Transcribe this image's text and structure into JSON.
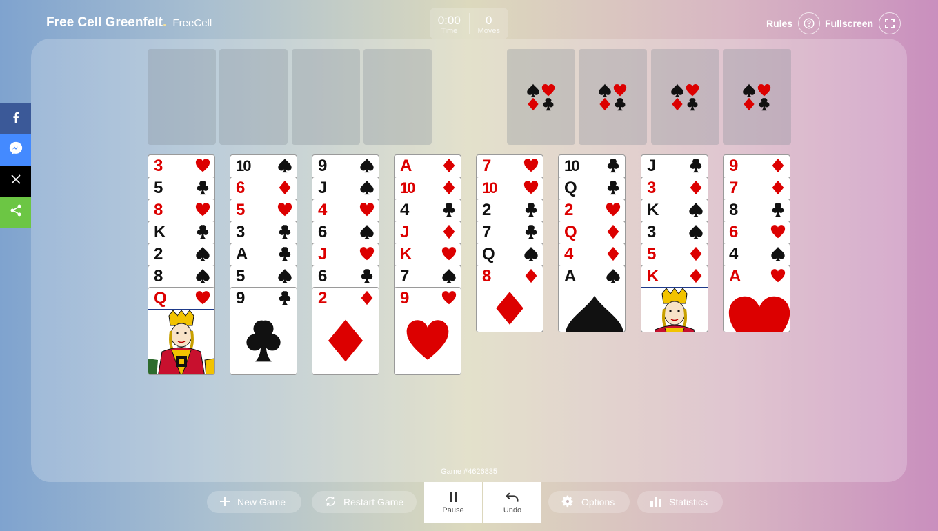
{
  "header": {
    "brand_title": "Free Cell Greenfelt",
    "brand_dot": ".",
    "brand_subtitle": "FreeCell"
  },
  "hud": {
    "time_value": "0:00",
    "time_label": "Time",
    "moves_value": "0",
    "moves_label": "Moves"
  },
  "top_right": {
    "rules_label": "Rules",
    "fullscreen_label": "Fullscreen"
  },
  "share_bar": [
    {
      "name": "facebook",
      "color": "#3b5998",
      "icon": "facebook-icon"
    },
    {
      "name": "messenger",
      "color": "#448aff",
      "icon": "messenger-icon"
    },
    {
      "name": "x",
      "color": "#000000",
      "icon": "x-icon"
    },
    {
      "name": "share",
      "color": "#6cc644",
      "icon": "share-icon"
    }
  ],
  "free_cells": 4,
  "foundations": 4,
  "tableau": [
    [
      [
        "3",
        "H"
      ],
      [
        "5",
        "C"
      ],
      [
        "8",
        "H"
      ],
      [
        "K",
        "C"
      ],
      [
        "2",
        "S"
      ],
      [
        "8",
        "S"
      ],
      [
        "Q",
        "H"
      ]
    ],
    [
      [
        "10",
        "S"
      ],
      [
        "6",
        "D"
      ],
      [
        "5",
        "H"
      ],
      [
        "3",
        "C"
      ],
      [
        "A",
        "C"
      ],
      [
        "5",
        "S"
      ],
      [
        "9",
        "C"
      ]
    ],
    [
      [
        "9",
        "S"
      ],
      [
        "J",
        "S"
      ],
      [
        "4",
        "H"
      ],
      [
        "6",
        "S"
      ],
      [
        "J",
        "H"
      ],
      [
        "6",
        "C"
      ],
      [
        "2",
        "D"
      ]
    ],
    [
      [
        "A",
        "D"
      ],
      [
        "10",
        "D"
      ],
      [
        "4",
        "C"
      ],
      [
        "J",
        "D"
      ],
      [
        "K",
        "H"
      ],
      [
        "7",
        "S"
      ],
      [
        "9",
        "H"
      ]
    ],
    [
      [
        "7",
        "H"
      ],
      [
        "10",
        "H"
      ],
      [
        "2",
        "C"
      ],
      [
        "7",
        "C"
      ],
      [
        "Q",
        "S"
      ],
      [
        "8",
        "D"
      ]
    ],
    [
      [
        "10",
        "C"
      ],
      [
        "Q",
        "C"
      ],
      [
        "2",
        "H"
      ],
      [
        "Q",
        "D"
      ],
      [
        "4",
        "D"
      ],
      [
        "A",
        "S"
      ]
    ],
    [
      [
        "J",
        "C"
      ],
      [
        "3",
        "D"
      ],
      [
        "K",
        "S"
      ],
      [
        "3",
        "S"
      ],
      [
        "5",
        "D"
      ],
      [
        "K",
        "D"
      ]
    ],
    [
      [
        "9",
        "D"
      ],
      [
        "7",
        "D"
      ],
      [
        "8",
        "C"
      ],
      [
        "6",
        "H"
      ],
      [
        "4",
        "S"
      ],
      [
        "A",
        "H"
      ]
    ]
  ],
  "game_number": "Game #4626835",
  "bottom": {
    "new_game": "New Game",
    "restart_game": "Restart Game",
    "pause": "Pause",
    "undo": "Undo",
    "options": "Options",
    "statistics": "Statistics"
  },
  "colors": {
    "red_suit": "#dc0000",
    "black_suit": "#111111"
  }
}
